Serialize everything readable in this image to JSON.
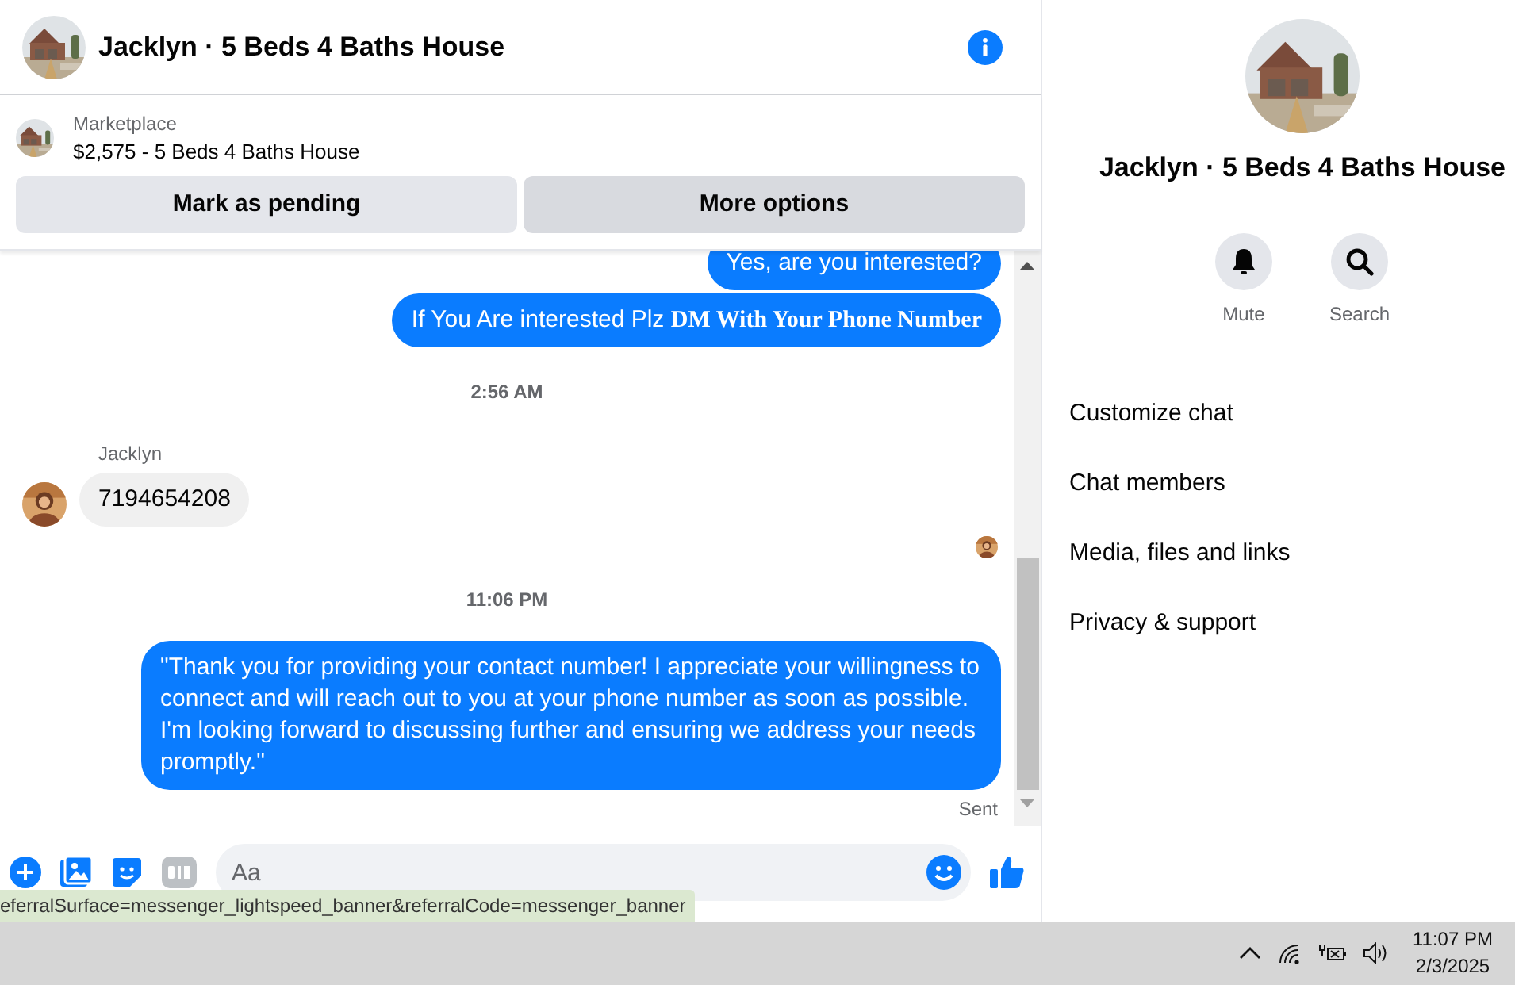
{
  "conversation": {
    "title": "Jacklyn · 5 Beds 4 Baths House"
  },
  "listing": {
    "label": "Marketplace",
    "title": "$2,575 - 5 Beds 4 Baths House",
    "buttons": [
      {
        "label": "Mark as pending",
        "kind": "primary"
      },
      {
        "label": "More options",
        "kind": "secondary"
      }
    ]
  },
  "messages": [
    {
      "kind": "outgoing",
      "text": "Yes, are you interested?"
    },
    {
      "kind": "outgoing",
      "text": "If You Are interested Plz **DM With Your Phone Number**"
    },
    {
      "kind": "timestamp",
      "text": "2:56 AM"
    },
    {
      "kind": "incoming",
      "sender": "Jacklyn",
      "text": "7194654208"
    },
    {
      "kind": "read_receipt"
    },
    {
      "kind": "timestamp",
      "text": "11:06 PM"
    },
    {
      "kind": "outgoing",
      "text": "\"Thank you for providing your contact number! I appreciate your willingness to connect and will reach out to you at your phone number as soon as possible. I'm looking forward to discussing further and ensuring we address your needs promptly.\""
    },
    {
      "kind": "status",
      "text": "Sent"
    }
  ],
  "composer": {
    "placeholder": "Aa"
  },
  "status_url": "eferralSurface=messenger_lightspeed_banner&referralCode=messenger_banner",
  "details": {
    "title": "Jacklyn · 5 Beds 4 Baths House",
    "actions": [
      {
        "label": "Mute",
        "kind": "bell"
      },
      {
        "label": "Search",
        "kind": "search"
      }
    ],
    "menu": [
      {
        "label": "Customize chat"
      },
      {
        "label": "Chat members"
      },
      {
        "label": "Media, files and links"
      },
      {
        "label": "Privacy & support"
      }
    ]
  },
  "taskbar": {
    "time": "11:07 PM",
    "date": "2/3/2025"
  }
}
